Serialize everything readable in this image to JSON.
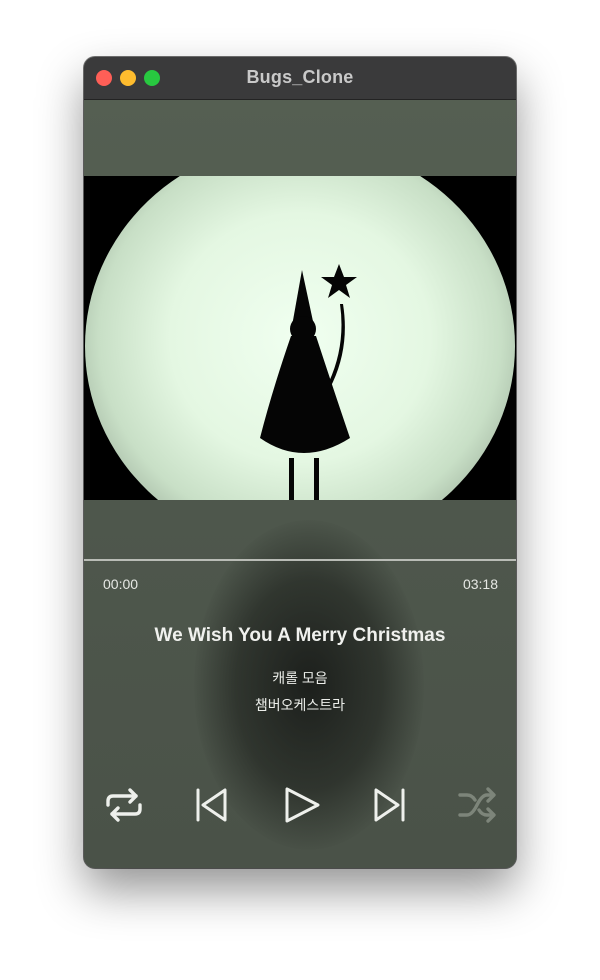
{
  "window": {
    "title": "Bugs_Clone"
  },
  "player": {
    "current_time": "00:00",
    "total_time": "03:18",
    "progress": 0.0,
    "track_title": "We Wish You A Merry Christmas",
    "album": "캐롤 모음",
    "artist": "챔버오케스트라"
  },
  "controls": {
    "repeat_icon": "repeat-icon",
    "previous_icon": "skip-back-icon",
    "play_icon": "play-icon",
    "next_icon": "skip-forward-icon",
    "shuffle_icon": "shuffle-icon",
    "shuffle_enabled": false
  },
  "colors": {
    "background": "#4e574c",
    "titlebar": "#3a3a3b",
    "control_active": "#eef0ec",
    "control_disabled": "#7d857a",
    "artwork_glow": "#dff5dc"
  }
}
